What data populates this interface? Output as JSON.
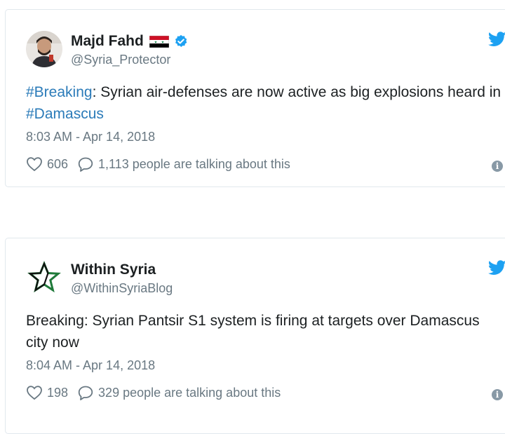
{
  "tweets": [
    {
      "display_name": "Majd Fahd",
      "handle": "@Syria_Protector",
      "verified": true,
      "flag": "syria-flag",
      "text_parts": [
        "#Breaking",
        ": Syrian air-defenses are now active as big explosions heard in ",
        "#Damascus"
      ],
      "timestamp": "8:03 AM - Apr 14, 2018",
      "likes": "606",
      "talking": "1,113 people are talking about this"
    },
    {
      "display_name": "Within Syria",
      "handle": "@WithinSyriaBlog",
      "verified": false,
      "text": "Breaking: Syrian Pantsir S1 system is firing at targets over Damascus city now",
      "timestamp": "8:04 AM - Apr 14, 2018",
      "likes": "198",
      "talking": "329 people are talking about this"
    }
  ],
  "icons": {
    "brand": "twitter-bird-icon",
    "like": "heart-icon",
    "reply": "speech-bubble-icon",
    "info": "info-icon",
    "verified": "verified-badge-icon"
  },
  "colors": {
    "link": "#2b7bb9",
    "twitter_blue": "#1da1f2",
    "secondary_text": "#697882",
    "border": "#e1e8ed"
  }
}
